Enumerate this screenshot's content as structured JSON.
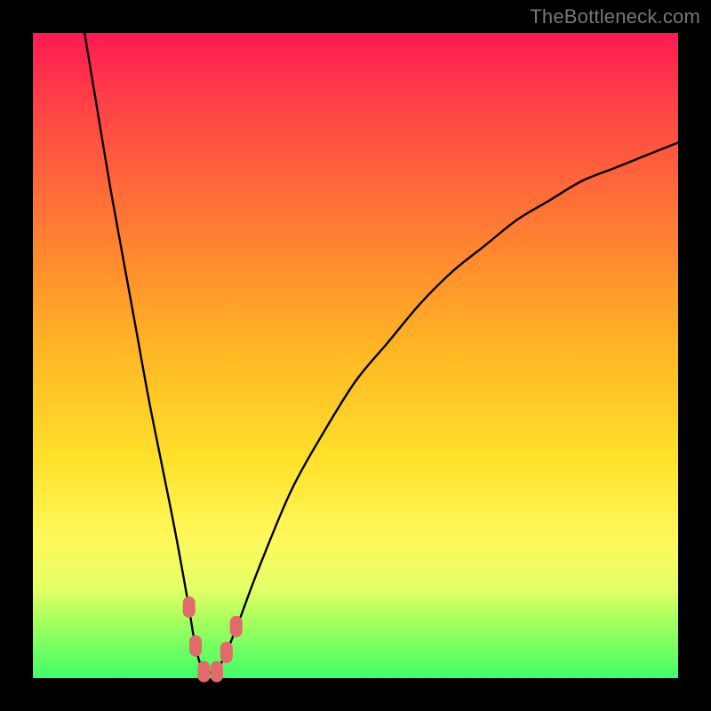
{
  "watermark": "TheBottleneck.com",
  "chart_data": {
    "type": "line",
    "title": "",
    "xlabel": "",
    "ylabel": "",
    "xlim": [
      0,
      100
    ],
    "ylim": [
      0,
      100
    ],
    "series": [
      {
        "name": "bottleneck-curve",
        "x": [
          8,
          10,
          12,
          14,
          16,
          18,
          20,
          22,
          24,
          25,
          26,
          27,
          28,
          29,
          30,
          32,
          35,
          40,
          45,
          50,
          55,
          60,
          65,
          70,
          75,
          80,
          85,
          90,
          95,
          100
        ],
        "values": [
          100,
          88,
          76,
          65,
          54,
          43,
          33,
          23,
          12,
          6,
          2,
          1,
          1,
          2,
          4,
          9,
          17,
          29,
          38,
          46,
          52,
          58,
          63,
          67,
          71,
          74,
          77,
          79,
          81,
          83
        ]
      }
    ],
    "markers": [
      {
        "name": "marker-left-1",
        "x": 24.2,
        "y": 11
      },
      {
        "name": "marker-left-2",
        "x": 25.2,
        "y": 5
      },
      {
        "name": "marker-bottom-1",
        "x": 26.5,
        "y": 1
      },
      {
        "name": "marker-bottom-2",
        "x": 28.5,
        "y": 1
      },
      {
        "name": "marker-right-1",
        "x": 30.0,
        "y": 4
      },
      {
        "name": "marker-right-2",
        "x": 31.5,
        "y": 8
      }
    ],
    "colors": {
      "curve": "#000000",
      "marker": "#e26a6a",
      "gradient_top": "#ff1a52",
      "gradient_bottom": "#3dff68"
    }
  }
}
